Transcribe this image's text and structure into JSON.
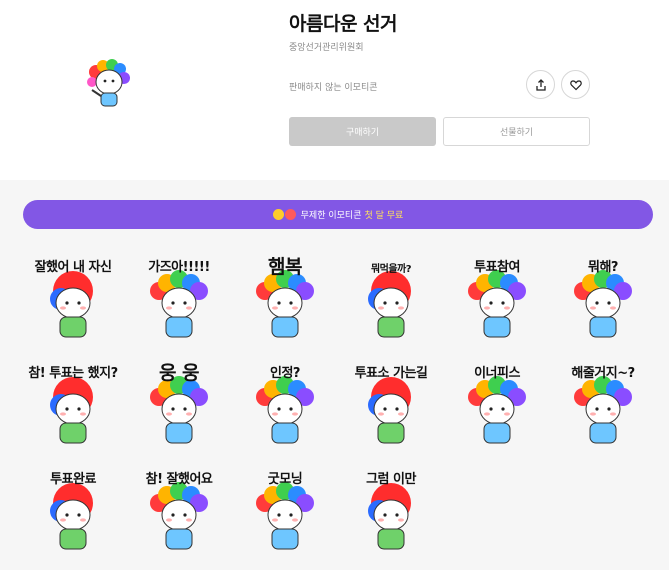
{
  "product": {
    "title": "아름다운 선거",
    "author": "중앙선거관리위원회",
    "sale_status": "판매하지 않는 이모티콘"
  },
  "actions": {
    "buy_label": "구매하기",
    "gift_label": "선물하기",
    "share_icon": "share-icon",
    "like_icon": "heart-icon"
  },
  "banner": {
    "text": "무제한 이모티콘",
    "highlight": "첫 달 무료"
  },
  "colors": {
    "purple": "#8257e5",
    "highlight": "#ffe25a",
    "disabled_button": "#c9c9c9"
  },
  "stickers": [
    {
      "caption": "잘했어 내 자신"
    },
    {
      "caption": "가즈아!!!!!"
    },
    {
      "caption": "햄복"
    },
    {
      "caption": "뭐먹을까?"
    },
    {
      "caption": "투표참여"
    },
    {
      "caption": "뭐해?"
    },
    {
      "caption": "참! 투표는 했지?"
    },
    {
      "caption": "웅 웅"
    },
    {
      "caption": "인정?"
    },
    {
      "caption": "투표소 가는길"
    },
    {
      "caption": "이너피스"
    },
    {
      "caption": "해줄거지~?"
    },
    {
      "caption": "투표완료"
    },
    {
      "caption": "참! 잘했어요"
    },
    {
      "caption": "굿모닝"
    },
    {
      "caption": "그럼 이만"
    }
  ]
}
